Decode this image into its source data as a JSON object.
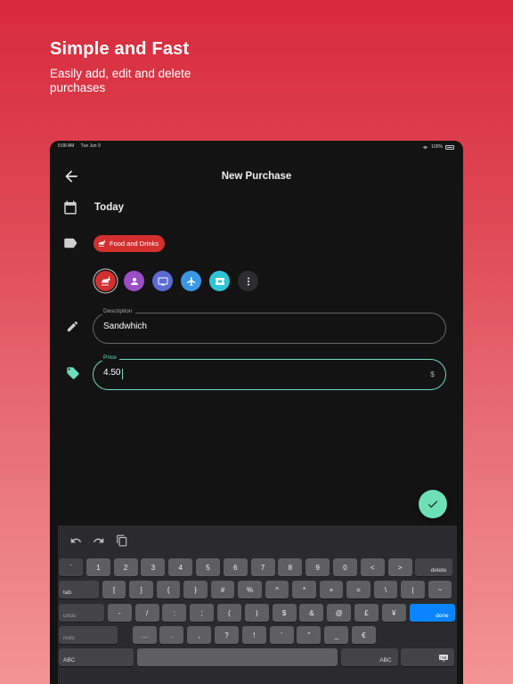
{
  "promo": {
    "title": "Simple and Fast",
    "subtitle": "Easily add, edit and delete purchases"
  },
  "statusbar": {
    "time": "6:08 AM",
    "date": "Tue Jun 9",
    "battery": "100%"
  },
  "appbar": {
    "title": "New Purchase",
    "back_icon": "arrow-back-icon"
  },
  "date_row": {
    "icon": "calendar-icon",
    "value": "Today"
  },
  "category_row": {
    "icon": "label-tag-icon",
    "selected_chip": "Food and Drinks",
    "options": [
      {
        "name": "food",
        "icon": "food-icon",
        "color": "#d32f2f"
      },
      {
        "name": "person",
        "icon": "person-icon",
        "color": "#9c4dc6"
      },
      {
        "name": "tv",
        "icon": "tv-icon",
        "color": "#5b6bd0"
      },
      {
        "name": "travel",
        "icon": "airplane-icon",
        "color": "#3a97e6"
      },
      {
        "name": "tickets",
        "icon": "ticket-icon",
        "color": "#2ec4d6"
      },
      {
        "name": "more",
        "icon": "more-vert-icon",
        "color": "#2d2d2f"
      }
    ]
  },
  "description_field": {
    "label": "Description",
    "value": "Sandwhich",
    "icon": "pencil-icon"
  },
  "price_field": {
    "label": "Price",
    "value": "4.50",
    "suffix": "$",
    "icon": "price-tag-icon"
  },
  "colors": {
    "accent": "#6ddcbc",
    "chip": "#d32f2f",
    "background": "#131314"
  },
  "keyboard": {
    "row1": [
      "`",
      "1",
      "2",
      "3",
      "4",
      "5",
      "6",
      "7",
      "8",
      "9",
      "0",
      "<",
      ">",
      "delete"
    ],
    "row2": [
      "tab",
      "[",
      "]",
      "{",
      "}",
      "#",
      "%",
      "^",
      "*",
      "+",
      "=",
      "\\",
      "|",
      "~"
    ],
    "row3": [
      "undo",
      "-",
      "/",
      ":",
      ";",
      "(",
      ")",
      "$",
      "&",
      "@",
      "£",
      "¥",
      "done"
    ],
    "row4": [
      "redo",
      "...",
      ".",
      ",",
      "?",
      "!",
      "'",
      "\"",
      "_",
      "€"
    ],
    "row5": [
      "ABC",
      "",
      "ABC"
    ]
  }
}
